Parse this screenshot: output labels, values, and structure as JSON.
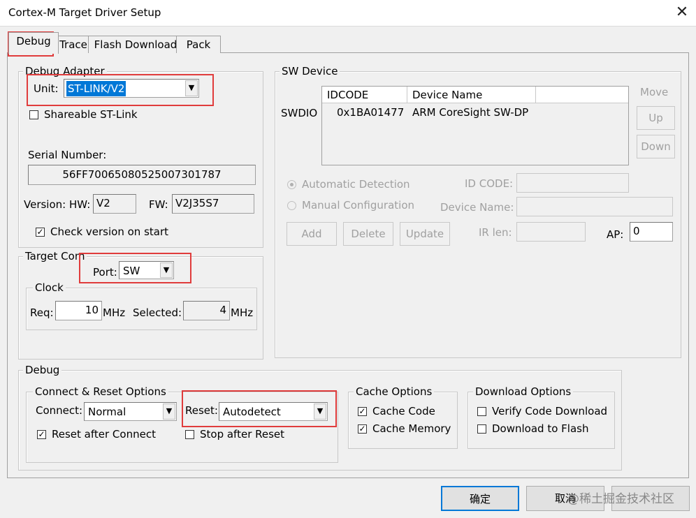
{
  "window": {
    "title": "Cortex-M Target Driver Setup",
    "close_glyph": "✕"
  },
  "tabs": [
    "Debug",
    "Trace",
    "Flash Download",
    "Pack"
  ],
  "debug_adapter": {
    "group_label": "Debug Adapter",
    "unit_label": "Unit:",
    "unit_value": "ST-LINK/V2",
    "shareable_label": "Shareable ST-Link",
    "serial_label": "Serial Number:",
    "serial_value": "56FF70065080525007301787",
    "version_label": "Version: HW:",
    "hw_value": "V2",
    "fw_label": "FW:",
    "fw_value": "V2J35S7",
    "check_version_label": "Check version on start"
  },
  "target_com": {
    "group_label": "Target Com",
    "port_label": "Port:",
    "port_value": "SW",
    "clock_label": "Clock",
    "req_label": "Req:",
    "req_value": "10",
    "mhz1": "MHz",
    "selected_label": "Selected:",
    "selected_value": "4",
    "mhz2": "MHz"
  },
  "sw_device": {
    "group_label": "SW Device",
    "move_label": "Move",
    "up_label": "Up",
    "down_label": "Down",
    "swdio_label": "SWDIO",
    "columns": [
      "IDCODE",
      "Device Name"
    ],
    "rows": [
      {
        "idcode": "0x1BA01477",
        "name": "ARM CoreSight SW-DP"
      }
    ],
    "auto_detect_label": "Automatic Detection",
    "manual_config_label": "Manual Configuration",
    "id_code_label": "ID CODE:",
    "device_name_label": "Device Name:",
    "add_label": "Add",
    "delete_label": "Delete",
    "update_label": "Update",
    "ir_len_label": "IR len:",
    "ap_label": "AP:",
    "ap_value": "0"
  },
  "debug_section": {
    "group_label": "Debug",
    "connect_reset_label": "Connect & Reset Options",
    "connect_label": "Connect:",
    "connect_value": "Normal",
    "reset_label": "Reset:",
    "reset_value": "Autodetect",
    "reset_after_connect_label": "Reset after Connect",
    "stop_after_reset_label": "Stop after Reset",
    "cache_options_label": "Cache Options",
    "cache_code_label": "Cache Code",
    "cache_memory_label": "Cache Memory",
    "download_options_label": "Download Options",
    "verify_code_label": "Verify Code Download",
    "download_flash_label": "Download to Flash"
  },
  "buttons": {
    "ok": "确定",
    "cancel": "取消"
  },
  "watermark": "@稀土掘金技术社区",
  "colors": {
    "highlight_red": "#e03c3c",
    "selection_blue": "#0078d7"
  }
}
